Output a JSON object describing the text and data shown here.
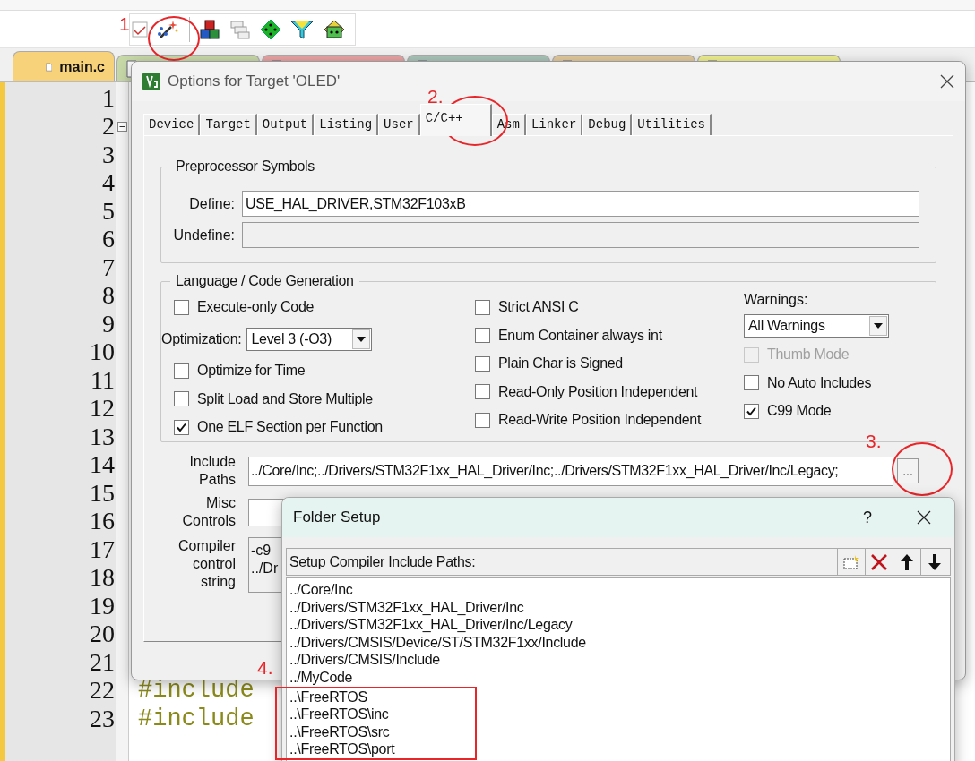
{
  "toolbar": {
    "annotation": "1"
  },
  "editor_tabs": [
    {
      "label": "main.c",
      "selected": true,
      "color": "#f7d27a"
    },
    {
      "selected": false,
      "color": "#c8d9a8"
    },
    {
      "selected": false,
      "color": "#e9a3a3"
    },
    {
      "selected": false,
      "color": "#a9c4b8"
    },
    {
      "selected": false,
      "color": "#e2c99c"
    },
    {
      "selected": false,
      "color": "#eeee8e"
    }
  ],
  "editor": {
    "lines": [
      {
        "number": "1"
      },
      {
        "number": "2",
        "fold": true
      },
      {
        "number": "3"
      },
      {
        "number": "4"
      },
      {
        "number": "5"
      },
      {
        "number": "6"
      },
      {
        "number": "7"
      },
      {
        "number": "8"
      },
      {
        "number": "9"
      },
      {
        "number": "10"
      },
      {
        "number": "11"
      },
      {
        "number": "12"
      },
      {
        "number": "13"
      },
      {
        "number": "14"
      },
      {
        "number": "15"
      },
      {
        "number": "16"
      },
      {
        "number": "17"
      },
      {
        "number": "18"
      },
      {
        "number": "19"
      },
      {
        "number": "20"
      },
      {
        "number": "21"
      },
      {
        "number": "22",
        "text": "#include"
      },
      {
        "number": "23",
        "text": "#include"
      }
    ]
  },
  "options_dialog": {
    "title": "Options for Target 'OLED'",
    "tabs_annotation": "2.",
    "tabs": [
      {
        "label": "Device",
        "selected": false
      },
      {
        "label": "Target",
        "selected": false
      },
      {
        "label": "Output",
        "selected": false
      },
      {
        "label": "Listing",
        "selected": false
      },
      {
        "label": "User",
        "selected": false
      },
      {
        "label": "C/C++",
        "selected": true
      },
      {
        "label": "Asm",
        "selected": false
      },
      {
        "label": "Linker",
        "selected": false
      },
      {
        "label": "Debug",
        "selected": false
      },
      {
        "label": "Utilities",
        "selected": false
      }
    ],
    "preprocessor": {
      "title": "Preprocessor Symbols",
      "define_label": "Define:",
      "define_value": "USE_HAL_DRIVER,STM32F103xB",
      "undefine_label": "Undefine:"
    },
    "code_generation": {
      "title": "Language / Code Generation",
      "column_1": [
        {
          "kind": "checkbox",
          "label": "Execute-only Code",
          "checked": false,
          "disabled": false
        },
        {
          "kind": "dropdown",
          "label": "Optimization:",
          "value": "Level 3 (-O3)"
        },
        {
          "kind": "checkbox",
          "label": "Optimize for Time",
          "checked": false,
          "disabled": false
        },
        {
          "kind": "checkbox",
          "label": "Split Load and Store Multiple",
          "checked": false,
          "disabled": false
        },
        {
          "kind": "checkbox",
          "label": "One ELF Section per Function",
          "checked": true,
          "disabled": false
        }
      ],
      "column_2": [
        {
          "kind": "checkbox",
          "label": "Strict ANSI C",
          "checked": false,
          "disabled": false
        },
        {
          "kind": "checkbox",
          "label": "Enum Container always int",
          "checked": false,
          "disabled": false
        },
        {
          "kind": "checkbox",
          "label": "Plain Char is Signed",
          "checked": false,
          "disabled": false
        },
        {
          "kind": "checkbox",
          "label": "Read-Only Position Independent",
          "checked": false,
          "disabled": false
        },
        {
          "kind": "checkbox",
          "label": "Read-Write Position Independent",
          "checked": false,
          "disabled": false
        }
      ],
      "warnings_label": "Warnings:",
      "warnings_value": "All Warnings",
      "column_3": [
        {
          "kind": "checkbox",
          "label": "Thumb Mode",
          "checked": false,
          "disabled": true
        },
        {
          "kind": "checkbox",
          "label": "No Auto Includes",
          "checked": false,
          "disabled": false
        },
        {
          "kind": "checkbox",
          "label": "C99 Mode",
          "checked": true,
          "disabled": false
        }
      ]
    },
    "include_paths": {
      "label_lines": [
        "Include",
        "Paths"
      ],
      "value": "../Core/Inc;../Drivers/STM32F1xx_HAL_Driver/Inc;../Drivers/STM32F1xx_HAL_Driver/Inc/Legacy;",
      "browse": "...",
      "annotation": "3."
    },
    "misc_controls": {
      "label_lines": [
        "Misc",
        "Controls"
      ]
    },
    "compiler_string": {
      "label_lines": [
        "Compiler",
        "control",
        "string"
      ],
      "value_lines": [
        "-c9",
        "../Dr"
      ]
    }
  },
  "folder_dialog": {
    "title": "Folder Setup",
    "help": "?",
    "list_label": "Setup Compiler Include Paths:",
    "annotation": "4.",
    "paths": [
      "../Core/Inc",
      "../Drivers/STM32F1xx_HAL_Driver/Inc",
      "../Drivers/STM32F1xx_HAL_Driver/Inc/Legacy",
      "../Drivers/CMSIS/Device/ST/STM32F1xx/Include",
      "../Drivers/CMSIS/Include",
      "../MyCode"
    ],
    "highlighted_paths": [
      "..\\FreeRTOS",
      "..\\FreeRTOS\\inc",
      "..\\FreeRTOS\\src",
      "..\\FreeRTOS\\port"
    ]
  }
}
